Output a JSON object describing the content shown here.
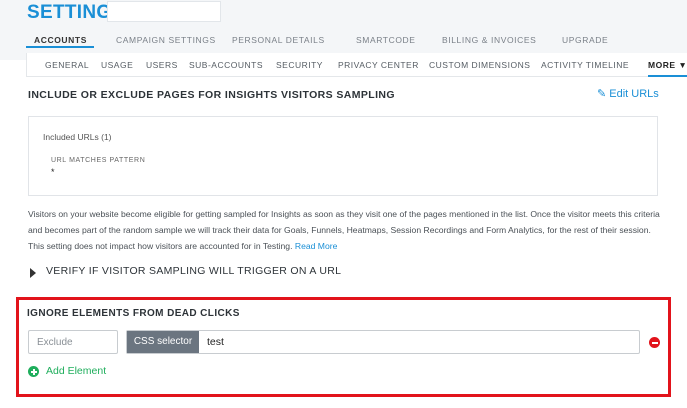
{
  "header": {
    "title": "SETTINGS",
    "search_value": ""
  },
  "tabs": [
    {
      "label": "ACCOUNTS",
      "active": true
    },
    {
      "label": "CAMPAIGN SETTINGS",
      "active": false
    },
    {
      "label": "PERSONAL DETAILS",
      "active": false
    },
    {
      "label": "SMARTCODE",
      "active": false
    },
    {
      "label": "BILLING & INVOICES",
      "active": false
    },
    {
      "label": "UPGRADE",
      "active": false
    }
  ],
  "subtabs": [
    {
      "label": "GENERAL"
    },
    {
      "label": "USAGE"
    },
    {
      "label": "USERS"
    },
    {
      "label": "SUB-ACCOUNTS"
    },
    {
      "label": "SECURITY"
    },
    {
      "label": "PRIVACY CENTER"
    },
    {
      "label": "CUSTOM DIMENSIONS"
    },
    {
      "label": "ACTIVITY TIMELINE"
    },
    {
      "label": "MORE ▼",
      "active": true
    }
  ],
  "sampling": {
    "title": "INCLUDE OR EXCLUDE PAGES FOR INSIGHTS VISITORS SAMPLING",
    "edit_label": "✎ Edit URLs",
    "included_label": "Included URLs (1)",
    "pattern_label": "URL MATCHES PATTERN",
    "pattern_value": "*",
    "description": "Visitors on your website become eligible for getting sampled for Insights as soon as they visit one of the pages mentioned in the list. Once the visitor meets this criteria and becomes part of the random sample we will track their data for Goals, Funnels, Heatmaps, Session Recordings and Form Analytics, for the rest of their session. This setting does not impact how visitors are accounted for in Testing.",
    "read_more": "Read More"
  },
  "verify": {
    "label": "VERIFY IF VISITOR SAMPLING WILL TRIGGER ON A URL"
  },
  "ignore": {
    "title": "IGNORE ELEMENTS FROM DEAD CLICKS",
    "exclude_value": "Exclude",
    "selector_label": "CSS selector",
    "selector_value": "test",
    "add_label": "Add Element"
  },
  "colors": {
    "accent": "#1a8fd6",
    "highlight_border": "#e2131b",
    "add_green": "#1fae5c",
    "remove_red": "#e2131b"
  },
  "icons": {
    "edit": "pencil-icon",
    "verify": "caret-right-icon",
    "remove": "minus-circle-icon",
    "add": "plus-circle-icon"
  }
}
